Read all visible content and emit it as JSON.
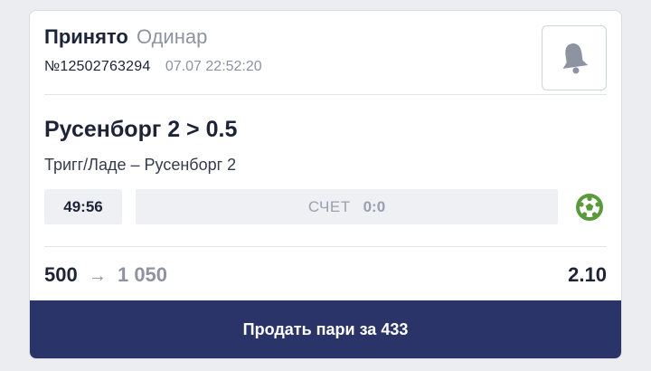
{
  "bet": {
    "status": "Принято",
    "type": "Одинар",
    "number": "№12502763294",
    "datetime": "07.07 22:52:20",
    "outcome": "Русенборг 2 > 0.5",
    "event": "Тригг/Ладе – Русенборг 2",
    "match_time": "49:56",
    "score_label": "СЧЕТ",
    "score_value": "0:0",
    "stake": "500",
    "payout": "1 050",
    "odds": "2.10"
  },
  "actions": {
    "sell_label": "Продать пари за 433"
  },
  "icons": {
    "notify": "bell-icon",
    "sport": "soccer-ball-icon",
    "arrow": "arrow-right-icon"
  },
  "colors": {
    "primary_text": "#1d2438",
    "muted_text": "#8d93a1",
    "button_bg": "#2a3468",
    "sport_icon": "#5a9a3c"
  }
}
